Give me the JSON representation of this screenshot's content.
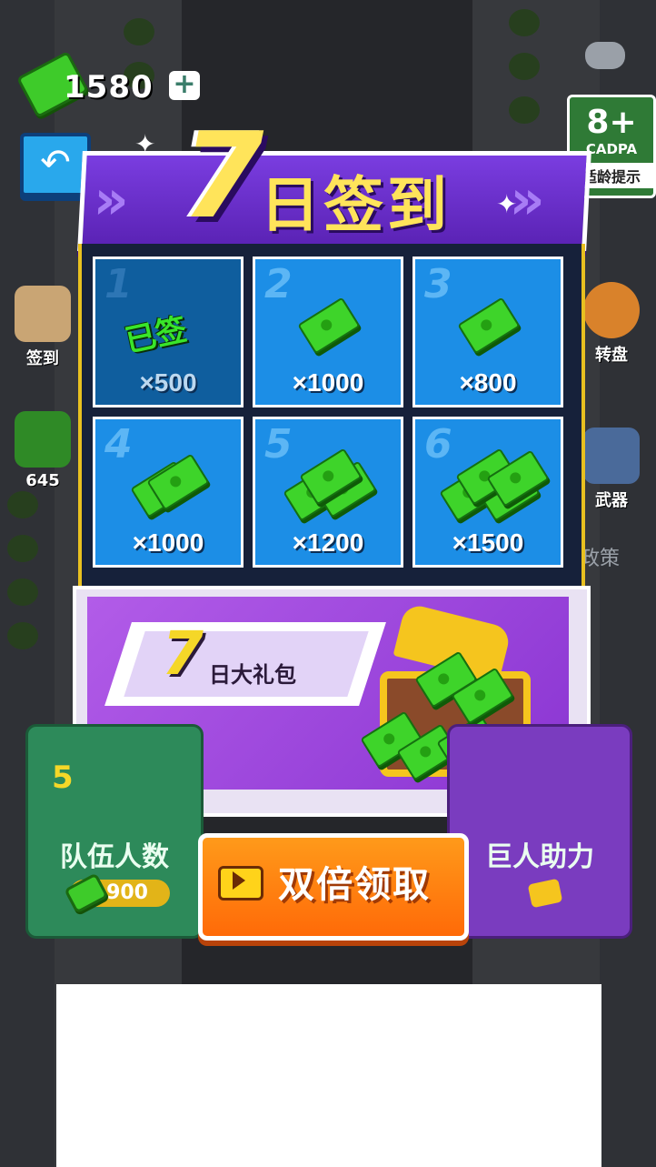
{
  "hud": {
    "cash": "1580",
    "plus": "+",
    "age_rating": "8+",
    "age_org": "CADPA",
    "age_tip": "适龄提示"
  },
  "side_left": {
    "signin_label": "签到",
    "cash_count": "645"
  },
  "side_right": {
    "wheel_label": "转盘",
    "weapon_label": "武器",
    "policy_text": "私政策"
  },
  "dialog": {
    "banner_number": "7",
    "banner_title": "日签到",
    "days": [
      {
        "day": "1",
        "amount": "×500",
        "claimed": true,
        "stamp": "已签"
      },
      {
        "day": "2",
        "amount": "×1000",
        "claimed": false
      },
      {
        "day": "3",
        "amount": "×800",
        "claimed": false
      },
      {
        "day": "4",
        "amount": "×1000",
        "claimed": false
      },
      {
        "day": "5",
        "amount": "×1200",
        "claimed": false
      },
      {
        "day": "6",
        "amount": "×1500",
        "claimed": false
      }
    ],
    "gift_number": "7",
    "gift_label": "日大礼包"
  },
  "bottom": {
    "team_number": "5",
    "team_label": "队伍人数",
    "team_cost": "900",
    "giant_label": "巨人助力",
    "double_claim": "双倍领取"
  },
  "colors": {
    "banner_purple": "#6a2fd0",
    "cell_blue": "#1c8ee6",
    "money_green": "#3ed42a",
    "gold": "#f5d728",
    "orange_button": "#ff7a10"
  }
}
